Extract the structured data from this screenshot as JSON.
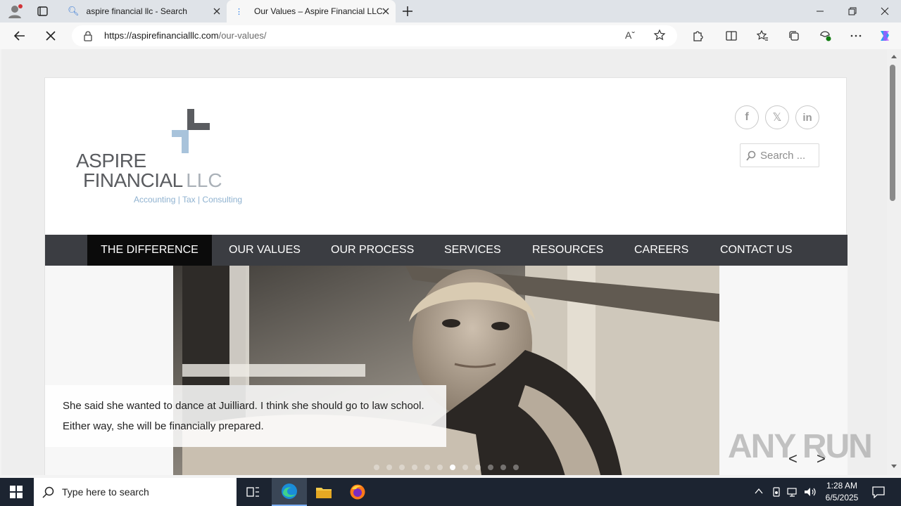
{
  "browser": {
    "tabs": [
      {
        "title": "aspire financial llc - Search"
      },
      {
        "title": "Our Values – Aspire Financial LLC"
      }
    ],
    "url_domain": "https://aspirefinancialllc.com",
    "url_path": "/our-values/"
  },
  "site": {
    "logo": {
      "line1": "ASPIRE",
      "line2_main": "FINANCIAL",
      "line2_suffix": "LLC",
      "tagline": "Accounting | Tax | Consulting"
    },
    "social": {
      "facebook": "f",
      "x": "𝕏",
      "linkedin": "in"
    },
    "search_placeholder": "Search ...",
    "nav": [
      "THE DIFFERENCE",
      "OUR VALUES",
      "OUR PROCESS",
      "SERVICES",
      "RESOURCES",
      "CAREERS",
      "CONTACT US"
    ],
    "slider": {
      "caption": "She said she wanted to dance at Juilliard. I think she should go to law school. Either way, she will be financially prepared.",
      "prev": "<",
      "next": ">",
      "slide_count": 12,
      "active_slide": 6
    }
  },
  "watermark": "ANY RUN",
  "taskbar": {
    "search_placeholder": "Type here to search",
    "time": "1:28 AM",
    "date": "6/5/2025"
  },
  "colors": {
    "nav_bg": "#3b3d42",
    "nav_active_bg": "#0b0b0b",
    "logo_blue": "#a8c3db",
    "logo_grey": "#5a5c60"
  }
}
